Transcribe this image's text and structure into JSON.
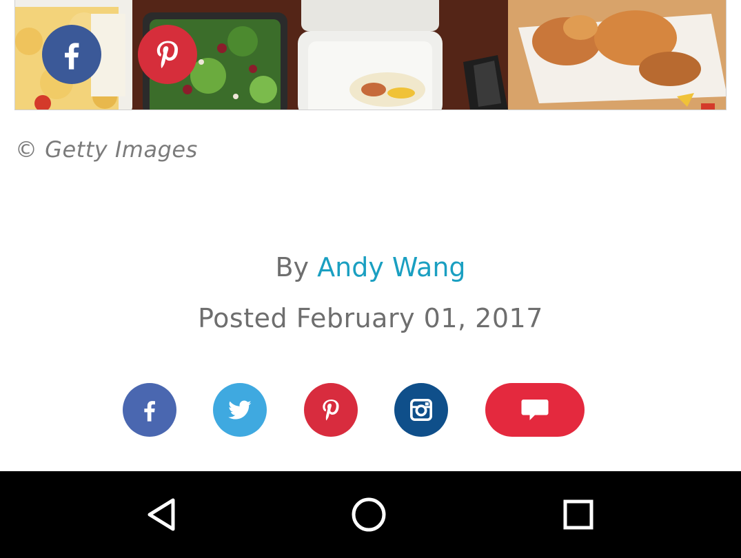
{
  "hero": {
    "share_icons": [
      "facebook-icon",
      "pinterest-icon"
    ],
    "colors": {
      "facebook": "#3b5998",
      "pinterest": "#d62e3b"
    }
  },
  "credit": "© Getty Images",
  "byline": {
    "prefix": "By",
    "author": "Andy Wang"
  },
  "posted": "Posted February 01, 2017",
  "share_bar": {
    "icons": [
      "facebook-icon",
      "twitter-icon",
      "pinterest-icon",
      "instagram-icon",
      "comment-icon"
    ],
    "colors": {
      "facebook": "#4a67b0",
      "twitter": "#3fa9e0",
      "pinterest": "#d82c3e",
      "instagram": "#0f4f8a",
      "comment": "#e4293e"
    }
  },
  "navbar": {
    "icons": [
      "back-icon",
      "home-icon",
      "recents-icon"
    ]
  },
  "accent": "#1a9fc1"
}
